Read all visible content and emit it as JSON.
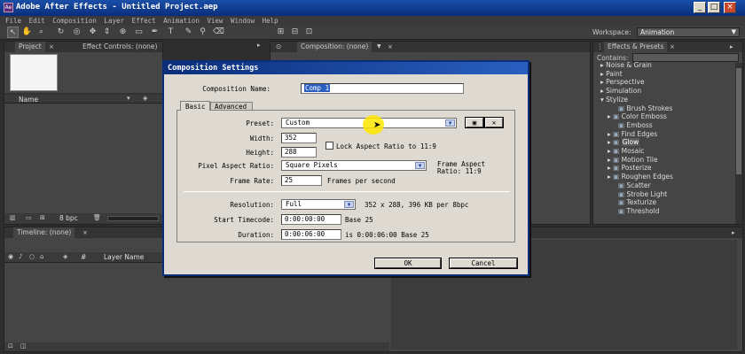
{
  "app": {
    "title": "Adobe After Effects - Untitled Project.aep"
  },
  "menu": [
    "File",
    "Edit",
    "Composition",
    "Layer",
    "Effect",
    "Animation",
    "View",
    "Window",
    "Help"
  ],
  "workspace": {
    "label": "Workspace:",
    "value": "Animation"
  },
  "project_panel": {
    "tab_project": "Project",
    "tab_effect_controls": "Effect Controls: (none)",
    "col_name": "Name",
    "bpc": "8 bpc"
  },
  "composition_panel": {
    "tab": "Composition: (none)"
  },
  "effects_panel": {
    "tab": "Effects & Presets",
    "contains_label": "Contains:",
    "categories": [
      "Noise & Grain",
      "Paint",
      "Perspective",
      "Simulation",
      "Stylize"
    ],
    "stylize_items": [
      "Brush Strokes",
      "Color Emboss",
      "Emboss",
      "Find Edges",
      "Glow",
      "Mosaic",
      "Motion Tile",
      "Posterize",
      "Roughen Edges",
      "Scatter",
      "Strobe Light",
      "Texturize",
      "Threshold"
    ],
    "selected": "Glow"
  },
  "timeline": {
    "tab": "Timeline: (none)",
    "col_layer_name": "Layer Name",
    "col_num": "#"
  },
  "dialog": {
    "title": "Composition Settings",
    "comp_name_label": "Composition Name:",
    "comp_name_value": "Comp 1",
    "tab_basic": "Basic",
    "tab_advanced": "Advanced",
    "preset_label": "Preset:",
    "preset_value": "Custom",
    "width_label": "Width:",
    "width_value": "352",
    "height_label": "Height:",
    "height_value": "288",
    "lock_aspect": "Lock Aspect Ratio to 11:9",
    "par_label": "Pixel Aspect Ratio:",
    "par_value": "Square Pixels",
    "frame_aspect_1": "Frame Aspect",
    "frame_aspect_2": "Ratio: 11:9",
    "frame_rate_label": "Frame Rate:",
    "frame_rate_value": "25",
    "frame_rate_unit": "Frames per second",
    "resolution_label": "Resolution:",
    "resolution_value": "Full",
    "resolution_info": "352 x 288, 396 KB per 8bpc",
    "start_tc_label": "Start Timecode:",
    "start_tc_value": "0:00:00:00",
    "start_tc_base": "Base 25",
    "duration_label": "Duration:",
    "duration_value": "0:00:06:00",
    "duration_info": "is 0:00:06:00  Base 25",
    "ok": "OK",
    "cancel": "Cancel"
  },
  "colors": {
    "title_bar": "#0a2e7a",
    "dialog_bg": "#dedad2",
    "selection": "#2a5fc0"
  }
}
